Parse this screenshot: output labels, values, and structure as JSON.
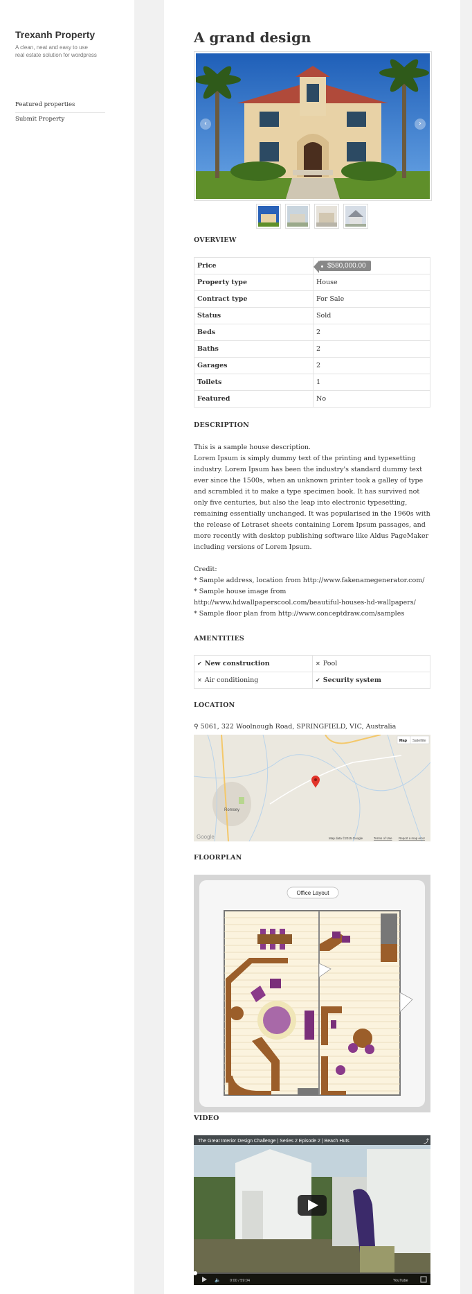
{
  "site": {
    "title": "Trexanh Property",
    "description": "A clean, neat and easy to use real estate solution for wordpress"
  },
  "nav": [
    {
      "label": "Featured properties"
    },
    {
      "label": "Submit Property"
    }
  ],
  "post": {
    "title": "A grand design"
  },
  "overview": {
    "heading": "OVERVIEW",
    "rows": [
      {
        "key": "Price",
        "value": "$580,000.00"
      },
      {
        "key": "Property type",
        "value": "House"
      },
      {
        "key": "Contract type",
        "value": "For Sale"
      },
      {
        "key": "Status",
        "value": "Sold"
      },
      {
        "key": "Beds",
        "value": "2"
      },
      {
        "key": "Baths",
        "value": "2"
      },
      {
        "key": "Garages",
        "value": "2"
      },
      {
        "key": "Toilets",
        "value": "1"
      },
      {
        "key": "Featured",
        "value": "No"
      }
    ]
  },
  "description": {
    "heading": "DESCRIPTION",
    "p1": "This is a sample house description.",
    "p2": "Lorem Ipsum is simply dummy text of the printing and typesetting industry. Lorem Ipsum has been the industry's standard dummy text ever since the 1500s, when an unknown printer took a galley of type and scrambled it to make a type specimen book. It has survived not only five centuries, but also the leap into electronic typesetting, remaining essentially unchanged. It was popularised in the 1960s with the release of Letraset sheets containing Lorem Ipsum passages, and more recently with desktop publishing software like Aldus PageMaker including versions of Lorem Ipsum.",
    "credit_label": "Credit:",
    "credits": [
      "* Sample address, location from http://www.fakenamegenerator.com/",
      "* Sample house image from http://www.hdwallpaperscool.com/beautiful-houses-hd-wallpapers/",
      "* Sample floor plan from http://www.conceptdraw.com/samples"
    ]
  },
  "amenities": {
    "heading": "AMENTITIES",
    "items": [
      {
        "label": "New construction",
        "available": true
      },
      {
        "label": "Pool",
        "available": false
      },
      {
        "label": "Air conditioning",
        "available": false
      },
      {
        "label": "Security system",
        "available": true
      }
    ]
  },
  "location": {
    "heading": "LOCATION",
    "address": "5061, 322 Woolnough Road, SPRINGFIELD, VIC, Australia",
    "map_buttons": [
      "Map",
      "Satellite"
    ],
    "map_labels": [
      "Romsey",
      "Google",
      "Map data ©2015 Google",
      "Terms of Use",
      "Report a map error"
    ]
  },
  "floorplan": {
    "heading": "FLOORPLAN",
    "title": "Office Layout"
  },
  "video": {
    "heading": "VIDEO",
    "title": "The Great Interior Design Challenge | Series 2 Episode 2 | Beach Huts",
    "time": "0:00 / 59:04",
    "brand": "YouTube"
  },
  "icons": {
    "check": "check-icon",
    "cross": "cross-icon",
    "pin": "map-pin-icon"
  }
}
